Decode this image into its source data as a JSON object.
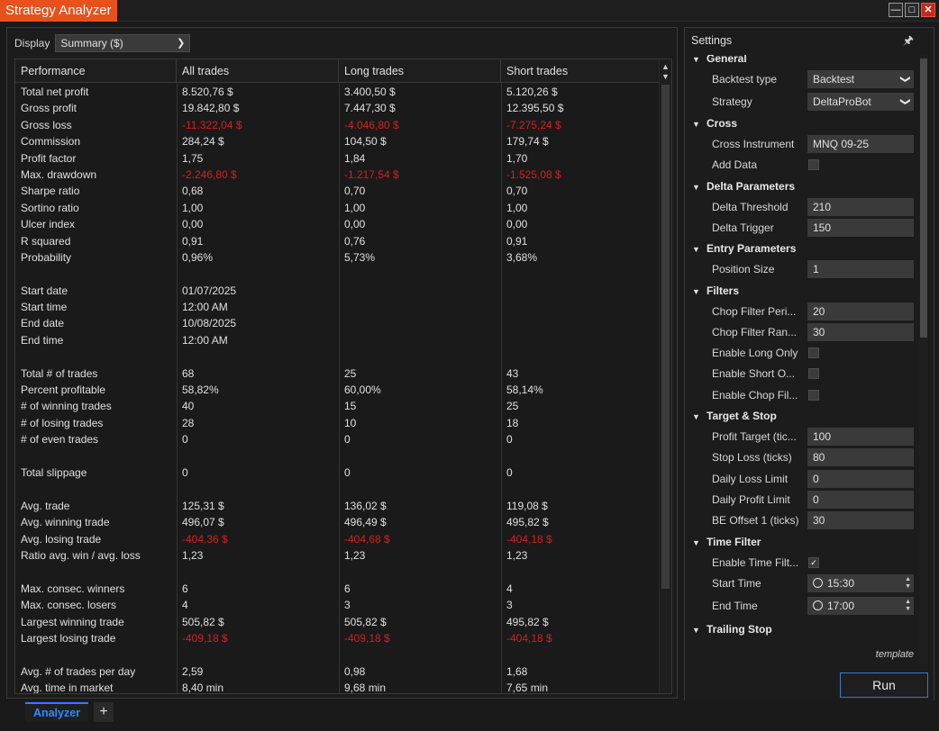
{
  "window": {
    "title": "Strategy Analyzer",
    "buttons": [
      "minimize-icon",
      "maximize-icon",
      "close-icon"
    ]
  },
  "display": {
    "label": "Display",
    "selected": "Summary ($)"
  },
  "table": {
    "headers": [
      "Performance",
      "All trades",
      "Long trades",
      "Short trades"
    ],
    "rows": [
      {
        "label": "Total net profit",
        "all": "8.520,76 $",
        "long": "3.400,50 $",
        "short": "5.120,26 $",
        "neg": false
      },
      {
        "label": "Gross profit",
        "all": "19.842,80 $",
        "long": "7.447,30 $",
        "short": "12.395,50 $",
        "neg": false
      },
      {
        "label": "Gross loss",
        "all": "-11.322,04 $",
        "long": "-4.046,80 $",
        "short": "-7.275,24 $",
        "neg": true
      },
      {
        "label": "Commission",
        "all": "284,24 $",
        "long": "104,50 $",
        "short": "179,74 $",
        "neg": false
      },
      {
        "label": "Profit factor",
        "all": "1,75",
        "long": "1,84",
        "short": "1,70",
        "neg": false
      },
      {
        "label": "Max. drawdown",
        "all": "-2.246,80 $",
        "long": "-1.217,54 $",
        "short": "-1.525,08 $",
        "neg": true
      },
      {
        "label": "Sharpe ratio",
        "all": "0,68",
        "long": "0,70",
        "short": "0,70",
        "neg": false
      },
      {
        "label": "Sortino ratio",
        "all": "1,00",
        "long": "1,00",
        "short": "1,00",
        "neg": false
      },
      {
        "label": "Ulcer index",
        "all": "0,00",
        "long": "0,00",
        "short": "0,00",
        "neg": false
      },
      {
        "label": "R squared",
        "all": "0,91",
        "long": "0,76",
        "short": "0,91",
        "neg": false
      },
      {
        "label": "Probability",
        "all": "0,96%",
        "long": "5,73%",
        "short": "3,68%",
        "neg": false
      },
      {
        "label": "",
        "all": "",
        "long": "",
        "short": "",
        "neg": false
      },
      {
        "label": "Start date",
        "all": "01/07/2025",
        "long": "",
        "short": "",
        "neg": false
      },
      {
        "label": "Start time",
        "all": "12:00 AM",
        "long": "",
        "short": "",
        "neg": false
      },
      {
        "label": "End date",
        "all": "10/08/2025",
        "long": "",
        "short": "",
        "neg": false
      },
      {
        "label": "End time",
        "all": "12:00 AM",
        "long": "",
        "short": "",
        "neg": false
      },
      {
        "label": "",
        "all": "",
        "long": "",
        "short": "",
        "neg": false
      },
      {
        "label": "Total # of trades",
        "all": "68",
        "long": "25",
        "short": "43",
        "neg": false
      },
      {
        "label": "Percent profitable",
        "all": "58,82%",
        "long": "60,00%",
        "short": "58,14%",
        "neg": false
      },
      {
        "label": "# of winning trades",
        "all": "40",
        "long": "15",
        "short": "25",
        "neg": false
      },
      {
        "label": "# of losing trades",
        "all": "28",
        "long": "10",
        "short": "18",
        "neg": false
      },
      {
        "label": "# of even trades",
        "all": "0",
        "long": "0",
        "short": "0",
        "neg": false
      },
      {
        "label": "",
        "all": "",
        "long": "",
        "short": "",
        "neg": false
      },
      {
        "label": "Total slippage",
        "all": "0",
        "long": "0",
        "short": "0",
        "neg": false
      },
      {
        "label": "",
        "all": "",
        "long": "",
        "short": "",
        "neg": false
      },
      {
        "label": "Avg. trade",
        "all": "125,31 $",
        "long": "136,02 $",
        "short": "119,08 $",
        "neg": false
      },
      {
        "label": "Avg. winning trade",
        "all": "496,07 $",
        "long": "496,49 $",
        "short": "495,82 $",
        "neg": false
      },
      {
        "label": "Avg. losing trade",
        "all": "-404,36 $",
        "long": "-404,68 $",
        "short": "-404,18 $",
        "neg": true
      },
      {
        "label": "Ratio avg. win / avg. loss",
        "all": "1,23",
        "long": "1,23",
        "short": "1,23",
        "neg": false
      },
      {
        "label": "",
        "all": "",
        "long": "",
        "short": "",
        "neg": false
      },
      {
        "label": "Max. consec. winners",
        "all": "6",
        "long": "6",
        "short": "4",
        "neg": false
      },
      {
        "label": "Max. consec. losers",
        "all": "4",
        "long": "3",
        "short": "3",
        "neg": false
      },
      {
        "label": "Largest winning trade",
        "all": "505,82 $",
        "long": "505,82 $",
        "short": "495,82 $",
        "neg": false
      },
      {
        "label": "Largest losing trade",
        "all": "-409,18 $",
        "long": "-409,18 $",
        "short": "-404,18 $",
        "neg": true
      },
      {
        "label": "",
        "all": "",
        "long": "",
        "short": "",
        "neg": false
      },
      {
        "label": "Avg. # of trades per day",
        "all": "2,59",
        "long": "0,98",
        "short": "1,68",
        "neg": false
      },
      {
        "label": "Avg. time in market",
        "all": "8,40 min",
        "long": "9,68 min",
        "short": "7,65 min",
        "neg": false
      }
    ]
  },
  "settings": {
    "title": "Settings",
    "template_label": "template",
    "run_label": "Run",
    "groups": [
      {
        "name": "General",
        "props": [
          {
            "label": "Backtest type",
            "type": "select",
            "value": "Backtest"
          },
          {
            "label": "Strategy",
            "type": "select",
            "value": "DeltaProBot"
          }
        ]
      },
      {
        "name": "Cross",
        "props": [
          {
            "label": "Cross Instrument",
            "type": "text",
            "value": "MNQ 09-25"
          },
          {
            "label": "Add Data",
            "type": "check",
            "value": false
          }
        ]
      },
      {
        "name": "Delta Parameters",
        "props": [
          {
            "label": "Delta Threshold",
            "type": "text",
            "value": "210"
          },
          {
            "label": "Delta Trigger",
            "type": "text",
            "value": "150"
          }
        ]
      },
      {
        "name": "Entry Parameters",
        "props": [
          {
            "label": "Position Size",
            "type": "text",
            "value": "1"
          }
        ]
      },
      {
        "name": "Filters",
        "props": [
          {
            "label": "Chop Filter Peri...",
            "type": "text",
            "value": "20"
          },
          {
            "label": "Chop Filter Ran...",
            "type": "text",
            "value": "30"
          },
          {
            "label": "Enable Long Only",
            "type": "check",
            "value": false
          },
          {
            "label": "Enable Short O...",
            "type": "check",
            "value": false
          },
          {
            "label": "Enable Chop Fil...",
            "type": "check",
            "value": false
          }
        ]
      },
      {
        "name": "Target & Stop",
        "props": [
          {
            "label": "Profit Target (tic...",
            "type": "text",
            "value": "100"
          },
          {
            "label": "Stop Loss (ticks)",
            "type": "text",
            "value": "80"
          },
          {
            "label": "Daily Loss Limit",
            "type": "text",
            "value": "0"
          },
          {
            "label": "Daily Profit Limit",
            "type": "text",
            "value": "0"
          },
          {
            "label": "BE Offset 1 (ticks)",
            "type": "text",
            "value": "30"
          }
        ]
      },
      {
        "name": "Time Filter",
        "props": [
          {
            "label": "Enable Time Filt...",
            "type": "check",
            "value": true
          },
          {
            "label": "Start Time",
            "type": "time",
            "value": "15:30"
          },
          {
            "label": "End Time",
            "type": "time",
            "value": "17:00"
          }
        ]
      },
      {
        "name": "Trailing Stop",
        "props": []
      }
    ]
  },
  "tabs": {
    "active": "Analyzer",
    "add": "+"
  },
  "colors": {
    "accent": "#e8501c",
    "negative": "#d42020",
    "tab_active": "#2f8cff"
  }
}
